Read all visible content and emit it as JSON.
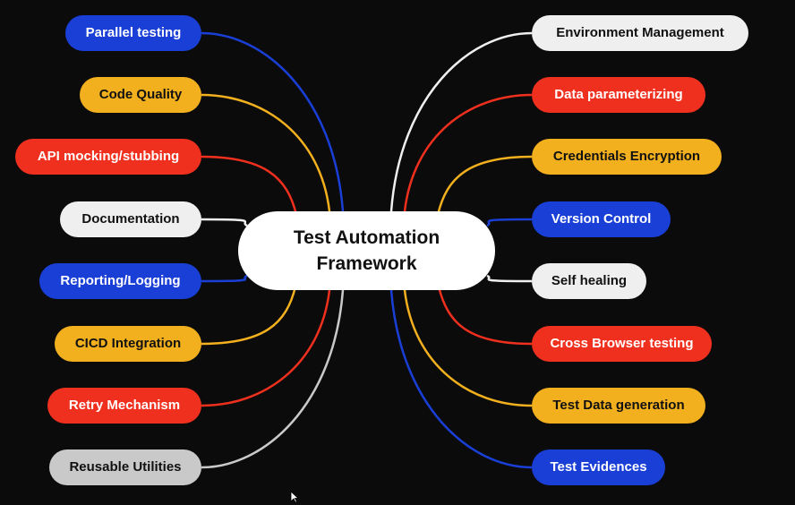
{
  "center": {
    "line1": "Test Automation",
    "line2": "Framework"
  },
  "left_nodes": [
    {
      "label": "Parallel testing",
      "color": "blue"
    },
    {
      "label": "Code Quality",
      "color": "yellow"
    },
    {
      "label": "API mocking/stubbing",
      "color": "red"
    },
    {
      "label": "Documentation",
      "color": "white"
    },
    {
      "label": "Reporting/Logging",
      "color": "blue"
    },
    {
      "label": "CICD Integration",
      "color": "yellow"
    },
    {
      "label": "Retry Mechanism",
      "color": "red"
    },
    {
      "label": "Reusable Utilities",
      "color": "grey"
    }
  ],
  "right_nodes": [
    {
      "label": "Environment Management",
      "color": "white"
    },
    {
      "label": "Data parameterizing",
      "color": "red"
    },
    {
      "label": "Credentials Encryption",
      "color": "yellow"
    },
    {
      "label": "Version Control",
      "color": "blue"
    },
    {
      "label": "Self healing",
      "color": "white"
    },
    {
      "label": "Cross Browser testing",
      "color": "red"
    },
    {
      "label": "Test Data generation",
      "color": "yellow"
    },
    {
      "label": "Test Evidences",
      "color": "blue"
    }
  ],
  "palette": {
    "blue": "#1a3fd6",
    "yellow": "#f2b01e",
    "red": "#f0301e",
    "white": "#efefef",
    "grey": "#c9c9c9",
    "background": "#0b0b0b"
  }
}
